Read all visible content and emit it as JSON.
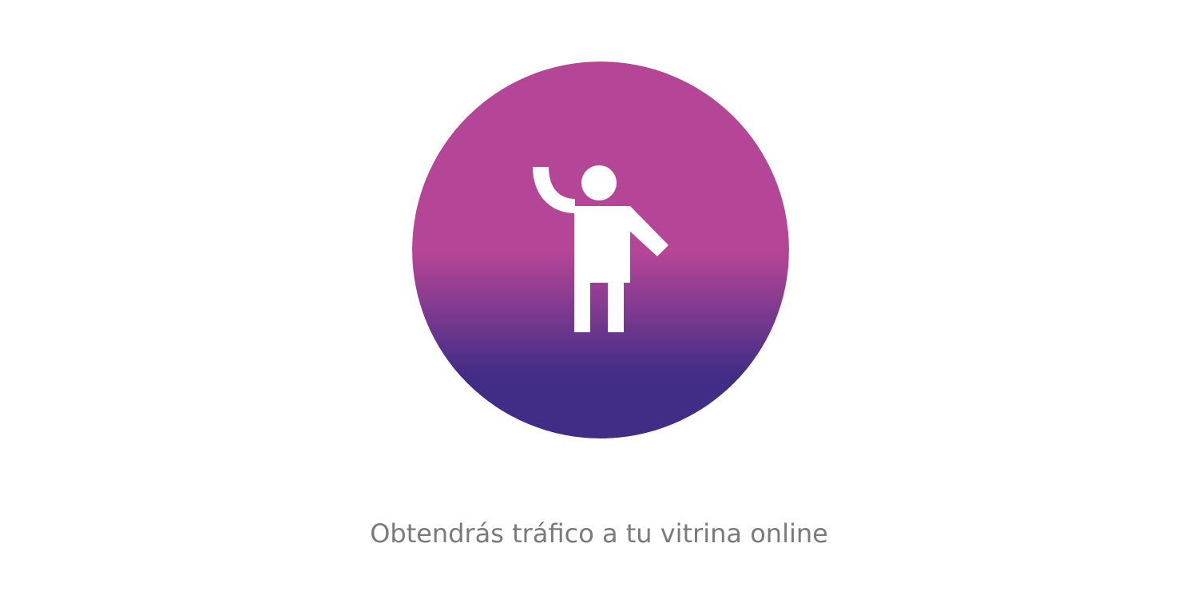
{
  "feature": {
    "icon": "person-waving-icon",
    "caption": "Obtendrás tráfico a tu vitrina online"
  },
  "colors": {
    "gradient_top": "#b44597",
    "gradient_bottom": "#422d86",
    "icon": "#ffffff",
    "caption_text": "#7a7a7a",
    "background": "#ffffff"
  }
}
